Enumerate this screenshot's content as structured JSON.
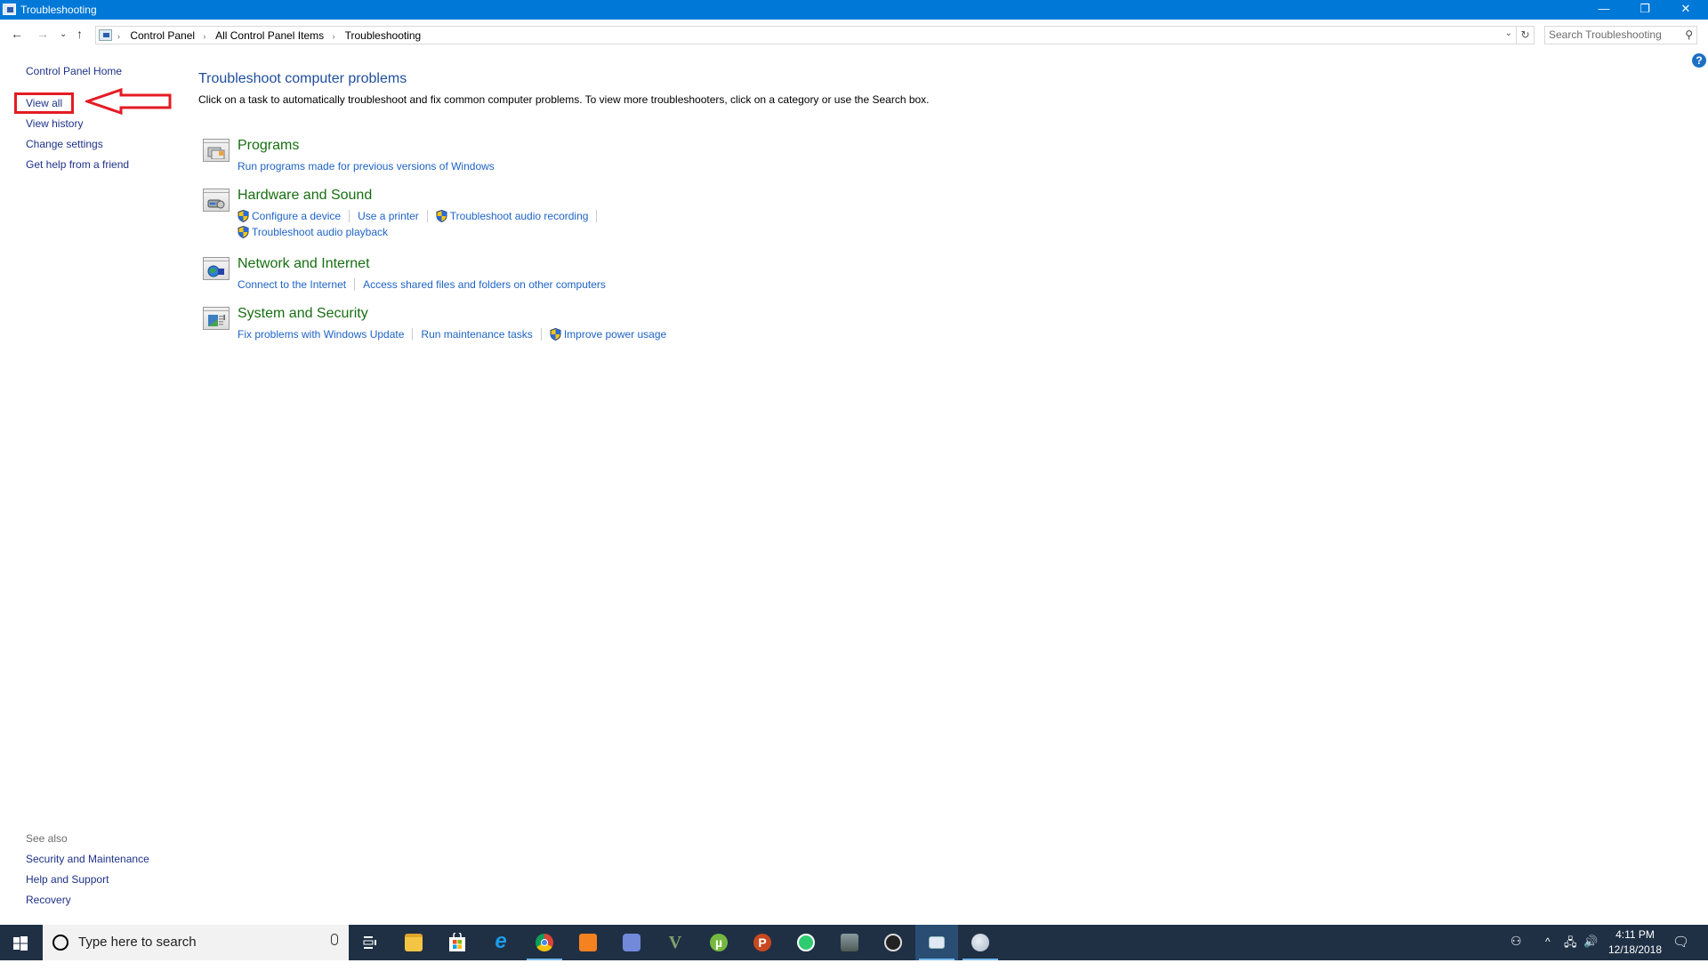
{
  "window": {
    "title": "Troubleshooting",
    "controls": {
      "minimize": "—",
      "restore": "❐",
      "close": "✕"
    }
  },
  "nav": {
    "back_icon": "←",
    "forward_icon": "→",
    "recent_icon": "⌄",
    "up_icon": "↑",
    "breadcrumb": [
      "Control Panel",
      "All Control Panel Items",
      "Troubleshooting"
    ],
    "breadcrumb_sep": "›",
    "dropdown_icon": "⌄",
    "refresh_icon": "↻",
    "search_placeholder": "Search Troubleshooting",
    "search_icon": "⚲",
    "help_icon": "?"
  },
  "left_pane": {
    "links": [
      "Control Panel Home",
      "View all",
      "View history",
      "Change settings",
      "Get help from a friend"
    ],
    "see_also_label": "See also",
    "see_also": [
      "Security and Maintenance",
      "Help and Support",
      "Recovery"
    ]
  },
  "annotation": {
    "highlight_target": "View all",
    "color": "#e41b23"
  },
  "main": {
    "title": "Troubleshoot computer problems",
    "description": "Click on a task to automatically troubleshoot and fix common computer problems. To view more troubleshooters, click on a category or use the Search box.",
    "categories": [
      {
        "title": "Programs",
        "icon": "programs-icon",
        "links": [
          {
            "label": "Run programs made for previous versions of Windows",
            "shield": false
          }
        ]
      },
      {
        "title": "Hardware and Sound",
        "icon": "hardware-sound-icon",
        "links": [
          {
            "label": "Configure a device",
            "shield": true
          },
          {
            "label": "Use a printer",
            "shield": false
          },
          {
            "label": "Troubleshoot audio recording",
            "shield": true
          },
          {
            "label": "Troubleshoot audio playback",
            "shield": true
          }
        ]
      },
      {
        "title": "Network and Internet",
        "icon": "network-internet-icon",
        "links": [
          {
            "label": "Connect to the Internet",
            "shield": false
          },
          {
            "label": "Access shared files and folders on other computers",
            "shield": false
          }
        ]
      },
      {
        "title": "System and Security",
        "icon": "system-security-icon",
        "links": [
          {
            "label": "Fix problems with Windows Update",
            "shield": false
          },
          {
            "label": "Run maintenance tasks",
            "shield": false
          },
          {
            "label": "Improve power usage",
            "shield": true
          }
        ]
      }
    ]
  },
  "taskbar": {
    "search_placeholder": "Type here to search",
    "apps": [
      {
        "name": "Task View",
        "icon": "task-view-icon"
      },
      {
        "name": "File Explorer",
        "icon": "file-explorer-icon"
      },
      {
        "name": "Microsoft Store",
        "icon": "store-icon"
      },
      {
        "name": "Internet Explorer",
        "icon": "internet-explorer-icon"
      },
      {
        "name": "Google Chrome",
        "icon": "chrome-icon",
        "running": true
      },
      {
        "name": "UC Browser",
        "icon": "uc-browser-icon"
      },
      {
        "name": "Discord",
        "icon": "discord-icon"
      },
      {
        "name": "Vortex",
        "icon": "v-app-icon"
      },
      {
        "name": "uTorrent",
        "icon": "utorrent-icon"
      },
      {
        "name": "Psiphon",
        "icon": "psiphon-icon"
      },
      {
        "name": "WhatsApp",
        "icon": "whatsapp-icon"
      },
      {
        "name": "Game",
        "icon": "game-icon"
      },
      {
        "name": "OBS",
        "icon": "obs-icon"
      },
      {
        "name": "Control Panel",
        "icon": "control-panel-icon",
        "running": true,
        "active": true
      },
      {
        "name": "Paint",
        "icon": "paint-icon",
        "running": true
      }
    ],
    "tray": {
      "people_icon": "⚇",
      "chevron_icon": "^",
      "network_icon": "🖧",
      "volume_icon": "🔊",
      "time": "4:11 PM",
      "date": "12/18/2018",
      "notifications_icon": "🗨"
    }
  }
}
